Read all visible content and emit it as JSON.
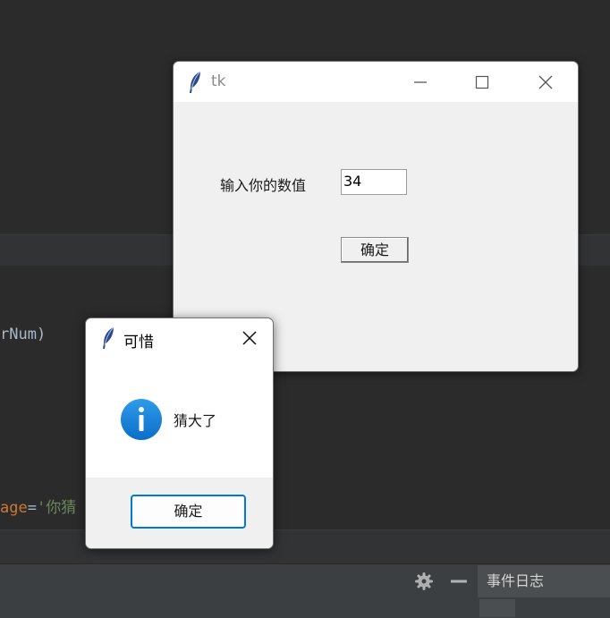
{
  "editor": {
    "code_line_1": "rNum)",
    "code_line_2_keyword": "age",
    "code_line_2_eq": "=",
    "code_line_2_string": "'你猜"
  },
  "bottom_bar": {
    "settings_icon": "gear-icon",
    "minimize_icon": "minus-icon",
    "event_log_label": "事件日志"
  },
  "tk_window": {
    "title": "tk",
    "prompt_label": "输入你的数值",
    "input_value": "34",
    "confirm_label": "确定"
  },
  "message_box": {
    "title": "可惜",
    "message": "猜大了",
    "icon": "info-icon",
    "ok_label": "确定"
  },
  "colors": {
    "editor_bg": "#2b2b2b",
    "keyword_orange": "#cc7832",
    "string_green": "#6a8759",
    "accent_blue": "#0078d7"
  }
}
